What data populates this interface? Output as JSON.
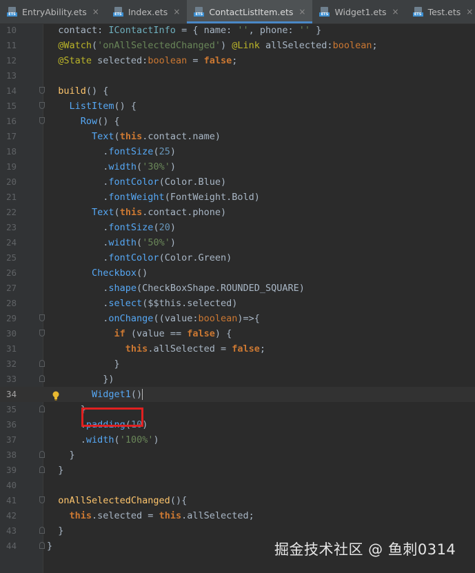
{
  "tabs": [
    {
      "label": "EntryAbility.ets",
      "active": false,
      "icon": "ets-file-icon"
    },
    {
      "label": "Index.ets",
      "active": false,
      "icon": "ets-file-icon"
    },
    {
      "label": "ContactListItem.ets",
      "active": true,
      "icon": "ets-file-icon"
    },
    {
      "label": "Widget1.ets",
      "active": false,
      "icon": "ets-file-icon"
    },
    {
      "label": "Test.ets",
      "active": false,
      "icon": "ets-file-icon"
    }
  ],
  "close_glyph": "×",
  "current_line": 34,
  "lines": [
    {
      "n": "10",
      "t": [
        [
          "plain",
          "  contact: "
        ],
        [
          "type",
          "IContactInfo"
        ],
        [
          "plain",
          " = { name: "
        ],
        [
          "str",
          "''"
        ],
        [
          "plain",
          ", phone: "
        ],
        [
          "str",
          "''"
        ],
        [
          "plain",
          " }"
        ]
      ]
    },
    {
      "n": "11",
      "t": [
        [
          "dec",
          "  @Watch"
        ],
        [
          "plain",
          "("
        ],
        [
          "str",
          "'onAllSelectedChanged'"
        ],
        [
          "plain",
          ") "
        ],
        [
          "dec",
          "@Link"
        ],
        [
          "plain",
          " allSelected:"
        ],
        [
          "kwn",
          "boolean"
        ],
        [
          "plain",
          ";"
        ]
      ]
    },
    {
      "n": "12",
      "t": [
        [
          "dec",
          "  @State"
        ],
        [
          "plain",
          " selected:"
        ],
        [
          "kwn",
          "boolean"
        ],
        [
          "plain",
          " = "
        ],
        [
          "kw",
          "false"
        ],
        [
          "plain",
          ";"
        ]
      ]
    },
    {
      "n": "13",
      "t": []
    },
    {
      "n": "14",
      "t": [
        [
          "fn",
          "  build"
        ],
        [
          "plain",
          "() {"
        ]
      ]
    },
    {
      "n": "15",
      "t": [
        [
          "comp",
          "    ListItem"
        ],
        [
          "plain",
          "() {"
        ]
      ]
    },
    {
      "n": "16",
      "t": [
        [
          "comp",
          "      Row"
        ],
        [
          "plain",
          "() {"
        ]
      ]
    },
    {
      "n": "17",
      "t": [
        [
          "comp",
          "        Text"
        ],
        [
          "plain",
          "("
        ],
        [
          "kw",
          "this"
        ],
        [
          "plain",
          ".contact.name)"
        ]
      ]
    },
    {
      "n": "18",
      "t": [
        [
          "plain",
          "          ."
        ],
        [
          "meth",
          "fontSize"
        ],
        [
          "plain",
          "("
        ],
        [
          "num",
          "25"
        ],
        [
          "plain",
          ")"
        ]
      ]
    },
    {
      "n": "19",
      "t": [
        [
          "plain",
          "          ."
        ],
        [
          "meth",
          "width"
        ],
        [
          "plain",
          "("
        ],
        [
          "str",
          "'30%'"
        ],
        [
          "plain",
          ")"
        ]
      ]
    },
    {
      "n": "20",
      "t": [
        [
          "plain",
          "          ."
        ],
        [
          "meth",
          "fontColor"
        ],
        [
          "plain",
          "(Color.Blue)"
        ]
      ]
    },
    {
      "n": "21",
      "t": [
        [
          "plain",
          "          ."
        ],
        [
          "meth",
          "fontWeight"
        ],
        [
          "plain",
          "(FontWeight.Bold)"
        ]
      ]
    },
    {
      "n": "22",
      "t": [
        [
          "comp",
          "        Text"
        ],
        [
          "plain",
          "("
        ],
        [
          "kw",
          "this"
        ],
        [
          "plain",
          ".contact.phone)"
        ]
      ]
    },
    {
      "n": "23",
      "t": [
        [
          "plain",
          "          ."
        ],
        [
          "meth",
          "fontSize"
        ],
        [
          "plain",
          "("
        ],
        [
          "num",
          "20"
        ],
        [
          "plain",
          ")"
        ]
      ]
    },
    {
      "n": "24",
      "t": [
        [
          "plain",
          "          ."
        ],
        [
          "meth",
          "width"
        ],
        [
          "plain",
          "("
        ],
        [
          "str",
          "'50%'"
        ],
        [
          "plain",
          ")"
        ]
      ]
    },
    {
      "n": "25",
      "t": [
        [
          "plain",
          "          ."
        ],
        [
          "meth",
          "fontColor"
        ],
        [
          "plain",
          "(Color.Green)"
        ]
      ]
    },
    {
      "n": "26",
      "t": [
        [
          "comp",
          "        Checkbox"
        ],
        [
          "plain",
          "()"
        ]
      ]
    },
    {
      "n": "27",
      "t": [
        [
          "plain",
          "          ."
        ],
        [
          "meth",
          "shape"
        ],
        [
          "plain",
          "(CheckBoxShape.ROUNDED_SQUARE)"
        ]
      ]
    },
    {
      "n": "28",
      "t": [
        [
          "plain",
          "          ."
        ],
        [
          "meth",
          "select"
        ],
        [
          "plain",
          "($$this.selected)"
        ]
      ]
    },
    {
      "n": "29",
      "t": [
        [
          "plain",
          "          ."
        ],
        [
          "meth",
          "onChange"
        ],
        [
          "plain",
          "((value:"
        ],
        [
          "kwn",
          "boolean"
        ],
        [
          "plain",
          ")=>{"
        ]
      ]
    },
    {
      "n": "30",
      "t": [
        [
          "kw",
          "            if"
        ],
        [
          "plain",
          " (value == "
        ],
        [
          "kw",
          "false"
        ],
        [
          "plain",
          ") {"
        ]
      ]
    },
    {
      "n": "31",
      "t": [
        [
          "kw",
          "              this"
        ],
        [
          "plain",
          ".allSelected = "
        ],
        [
          "kw",
          "false"
        ],
        [
          "plain",
          ";"
        ]
      ]
    },
    {
      "n": "32",
      "t": [
        [
          "plain",
          "            }"
        ]
      ]
    },
    {
      "n": "33",
      "t": [
        [
          "plain",
          "          })"
        ]
      ]
    },
    {
      "n": "34",
      "t": [
        [
          "comp",
          "        Widget1"
        ],
        [
          "plain",
          "()"
        ]
      ]
    },
    {
      "n": "35",
      "t": [
        [
          "plain",
          "      }"
        ]
      ]
    },
    {
      "n": "36",
      "t": [
        [
          "plain",
          "      ."
        ],
        [
          "meth",
          "padding"
        ],
        [
          "plain",
          "("
        ],
        [
          "num",
          "10"
        ],
        [
          "plain",
          ")"
        ]
      ]
    },
    {
      "n": "37",
      "t": [
        [
          "plain",
          "      ."
        ],
        [
          "meth",
          "width"
        ],
        [
          "plain",
          "("
        ],
        [
          "str",
          "'100%'"
        ],
        [
          "plain",
          ")"
        ]
      ]
    },
    {
      "n": "38",
      "t": [
        [
          "plain",
          "    }"
        ]
      ]
    },
    {
      "n": "39",
      "t": [
        [
          "plain",
          "  }"
        ]
      ]
    },
    {
      "n": "40",
      "t": []
    },
    {
      "n": "41",
      "t": [
        [
          "fn",
          "  onAllSelectedChanged"
        ],
        [
          "plain",
          "(){"
        ]
      ]
    },
    {
      "n": "42",
      "t": [
        [
          "kw",
          "    this"
        ],
        [
          "plain",
          ".selected = "
        ],
        [
          "kw",
          "this"
        ],
        [
          "plain",
          ".allSelected;"
        ]
      ]
    },
    {
      "n": "43",
      "t": [
        [
          "plain",
          "  }"
        ]
      ]
    },
    {
      "n": "44",
      "t": [
        [
          "plain",
          "}"
        ]
      ]
    }
  ],
  "folds": {
    "14": "open",
    "15": "open",
    "16": "open",
    "29": "open",
    "30": "open",
    "32": "close",
    "33": "close",
    "35": "close",
    "38": "close",
    "39": "close",
    "41": "open",
    "43": "close",
    "44": "close"
  },
  "watermark": "掘金技术社区 @ 鱼刺0314",
  "colors": {
    "background": "#2b2b2b",
    "keyword": "#cc7832",
    "string": "#6a8759",
    "number": "#6897bb",
    "highlight_box": "#e02020",
    "active_tab_underline": "#4a88c7"
  }
}
